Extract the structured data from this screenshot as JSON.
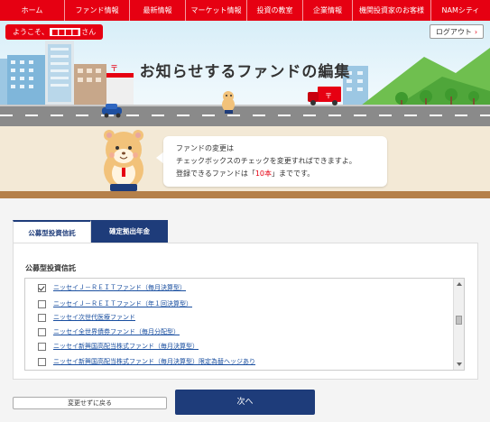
{
  "nav": {
    "items": [
      {
        "label": "ホーム"
      },
      {
        "label": "ファンド情報"
      },
      {
        "label": "最新情報"
      },
      {
        "label": "マーケット情報"
      },
      {
        "label": "投資の教室"
      },
      {
        "label": "企業情報"
      },
      {
        "label": "機関投資家のお客様"
      },
      {
        "label": "NAMシティ"
      }
    ]
  },
  "header": {
    "greeting_prefix": "ようこそ、",
    "user_name": "■■■■",
    "greeting_suffix": "さん",
    "logout_label": "ログアウト",
    "page_title": "お知らせするファンドの編集"
  },
  "info": {
    "line1": "ファンドの変更は",
    "line2": "チェックボックスのチェックを変更すればできますよ。",
    "line3_prefix": "登録できるファンドは「",
    "line3_highlight": "10本",
    "line3_suffix": "」までです。"
  },
  "tabs": [
    {
      "label": "公募型投資信託",
      "active": true
    },
    {
      "label": "確定拠出年金",
      "active": false
    }
  ],
  "section_label": "公募型投資信託",
  "funds": [
    {
      "label": "ニッセイＪ－ＲＥＩＴファンド（毎月決算型）",
      "checked": true
    },
    {
      "label": "ニッセイＪ－ＲＥＩＴファンド（年１回決算型）",
      "checked": false
    },
    {
      "label": "ニッセイ次世代医療ファンド",
      "checked": false
    },
    {
      "label": "ニッセイ全世界債券ファンド（毎月分配型）",
      "checked": false
    },
    {
      "label": "ニッセイ新興国高配当株式ファンド（毎月決算型）",
      "checked": false
    },
    {
      "label": "ニッセイ新興国高配当株式ファンド（毎月決算型）限定為替ヘッジあり",
      "checked": false
    }
  ],
  "actions": {
    "back_label": "変更せずに戻る",
    "next_label": "次へ"
  },
  "colors": {
    "brand_red": "#e60012",
    "navy": "#1e3c7a",
    "link_blue": "#1a4fa0"
  }
}
